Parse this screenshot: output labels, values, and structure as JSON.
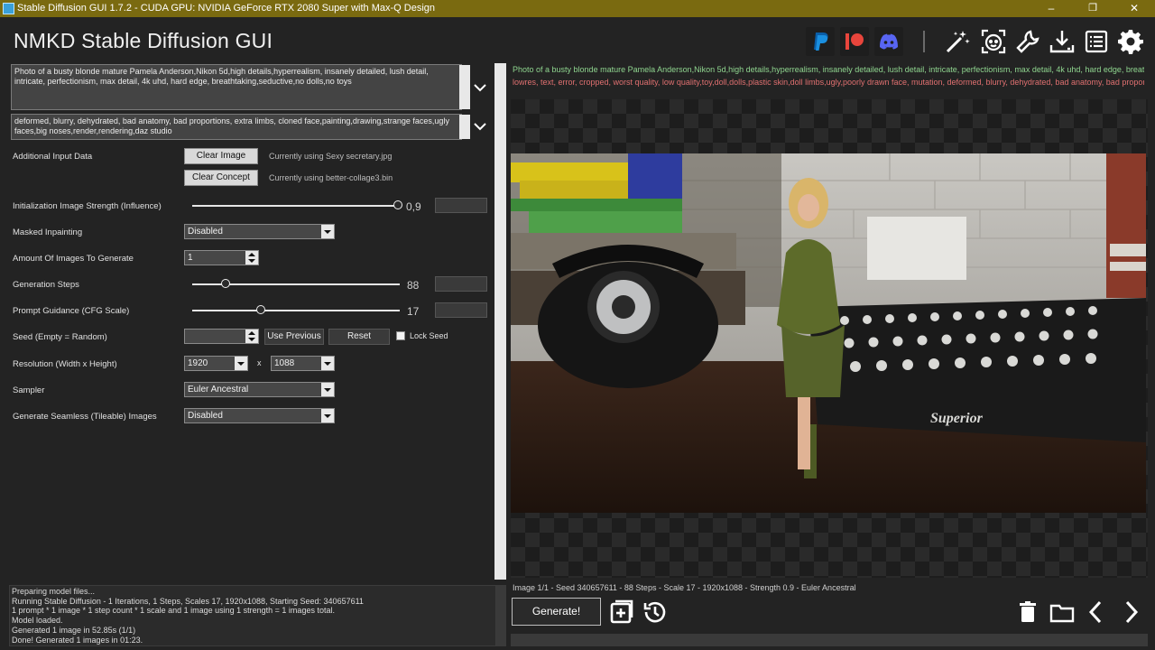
{
  "window": {
    "title": "Stable Diffusion GUI 1.7.2 - CUDA GPU: NVIDIA GeForce RTX 2080 Super with Max-Q Design",
    "minimize_glyph": "–",
    "maximize_glyph": "❐",
    "close_glyph": "✕"
  },
  "header": {
    "app_title": "NMKD Stable Diffusion GUI",
    "icons": [
      "paypal-icon",
      "patreon-icon",
      "discord-icon",
      "magic-wand-icon",
      "face-restore-icon",
      "wrench-icon",
      "install-icon",
      "list-icon",
      "settings-icon"
    ]
  },
  "prompts": {
    "positive": "Photo of a busty blonde mature Pamela Anderson,Nikon 5d,high details,hyperrealism, insanely detailed, lush detail, intricate, perfectionism, max detail, 4k uhd, hard edge, breathtaking,seductive,no dolls,no toys",
    "negative": "deformed, blurry, dehydrated, bad anatomy, bad proportions, extra limbs, cloned face,painting,drawing,strange faces,ugly faces,big noses,render,rendering,daz studio"
  },
  "form": {
    "additional_input_label": "Additional Input Data",
    "clear_image_label": "Clear Image",
    "current_image_note": "Currently using Sexy secretary.jpg",
    "clear_concept_label": "Clear Concept",
    "current_concept_note": "Currently using better-collage3.bin",
    "init_strength_label": "Initialization Image Strength (Influence)",
    "init_strength_value": "0,9",
    "init_strength_fraction": 0.9,
    "masked_inpainting_label": "Masked Inpainting",
    "masked_inpainting_value": "Disabled",
    "amount_label": "Amount Of Images To Generate",
    "amount_value": "1",
    "steps_label": "Generation Steps",
    "steps_value": "88",
    "cfg_label": "Prompt Guidance (CFG Scale)",
    "cfg_value": "17",
    "seed_label": "Seed (Empty = Random)",
    "seed_value": "",
    "use_previous_label": "Use Previous",
    "reset_label": "Reset",
    "lock_seed_label": "Lock Seed",
    "resolution_label": "Resolution (Width x Height)",
    "width_value": "1920",
    "x_label": "x",
    "height_value": "1088",
    "sampler_label": "Sampler",
    "sampler_value": "Euler Ancestral",
    "seamless_label": "Generate Seamless (Tileable) Images",
    "seamless_value": "Disabled"
  },
  "preview": {
    "prompt_line": "Photo of a busty blonde mature Pamela Anderson,Nikon 5d,high details,hyperrealism, insanely detailed, lush detail, intricate, perfectionism, max detail, 4k uhd, hard edge, breath...",
    "negative_line": "lowres, text, error, cropped, worst quality, low quality,toy,doll,dolls,plastic skin,doll limbs,ugly,poorly drawn face, mutation, deformed, blurry, dehydrated, bad anatomy, bad proporti...",
    "prompt_color": "#8fd58f",
    "negative_color": "#e07070",
    "typewriter_brand": "Superior",
    "image_info": "Image 1/1 - Seed 340657611 - 88 Steps - Scale 17 - 1920x1088 - Strength 0.9 - Euler Ancestral"
  },
  "log": {
    "lines": [
      "Preparing model files...",
      "Running Stable Diffusion - 1 Iterations, 1 Steps, Scales 17, 1920x1088, Starting Seed: 340657611",
      "1 prompt * 1 image * 1 step count * 1 scale and 1 image using 1 strength = 1 images total.",
      "Model loaded.",
      "Generated 1 image in 52.85s (1/1)",
      "Done! Generated 1 images in 01:23."
    ]
  },
  "bottom": {
    "generate_label": "Generate!",
    "icons": [
      "add-to-queue-icon",
      "history-icon",
      "delete-icon",
      "open-folder-icon",
      "previous-icon",
      "next-icon"
    ]
  },
  "colors": {
    "titlebar": "#7a6a10",
    "background": "#232323",
    "accent": "#3aa0d8"
  }
}
